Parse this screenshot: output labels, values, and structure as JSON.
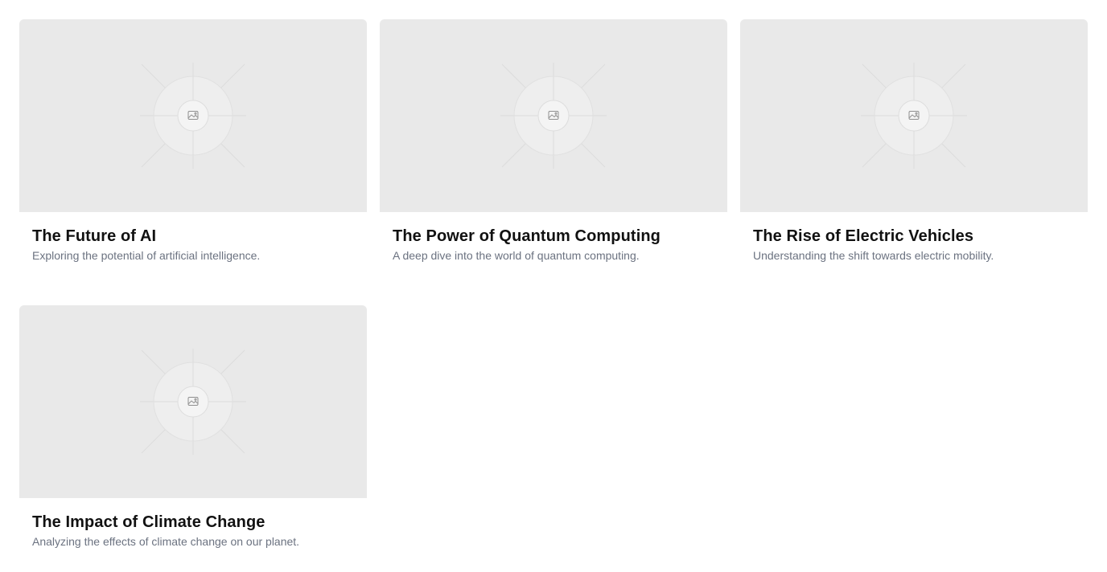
{
  "cards": [
    {
      "title": "The Future of AI",
      "description": "Exploring the potential of artificial intelligence.",
      "image_icon": "image-placeholder-icon"
    },
    {
      "title": "The Power of Quantum Computing",
      "description": "A deep dive into the world of quantum computing.",
      "image_icon": "image-placeholder-icon"
    },
    {
      "title": "The Rise of Electric Vehicles",
      "description": "Understanding the shift towards electric mobility.",
      "image_icon": "image-placeholder-icon"
    },
    {
      "title": "The Impact of Climate Change",
      "description": "Analyzing the effects of climate change on our planet.",
      "image_icon": "image-placeholder-icon"
    }
  ],
  "colors": {
    "placeholder_bg": "#e9e9e9",
    "title": "#111111",
    "description": "#6b7280"
  }
}
